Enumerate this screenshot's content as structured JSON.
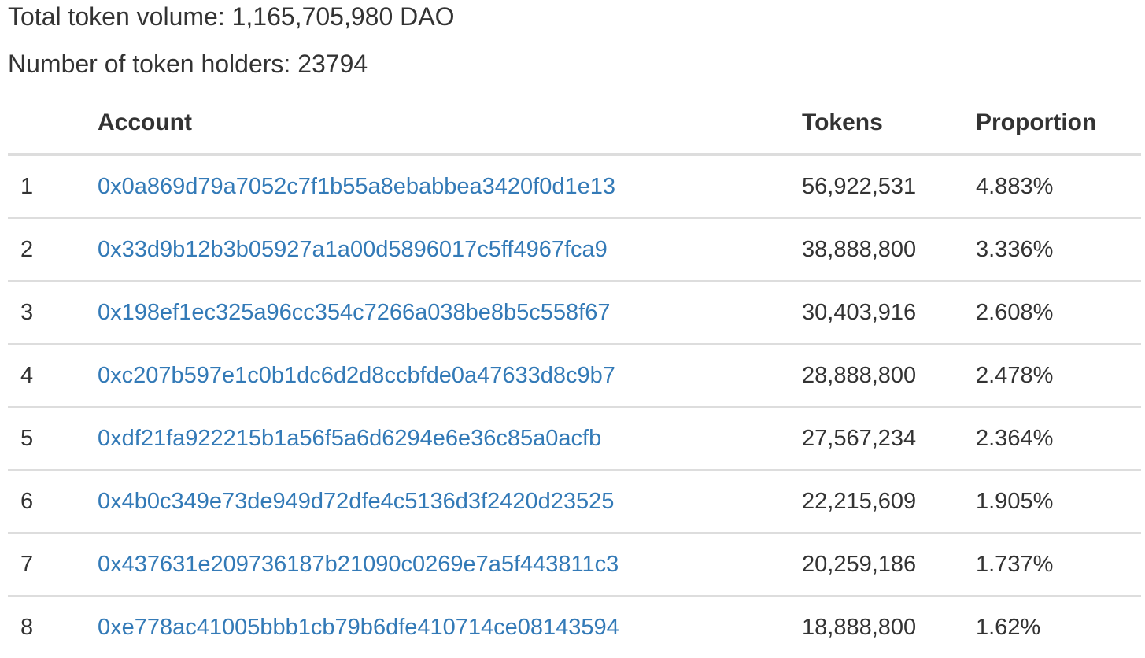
{
  "summary": {
    "total_label": "Total token volume: ",
    "total_value": "1,165,705,980 DAO",
    "holders_label": "Number of token holders: ",
    "holders_value": "23794"
  },
  "table": {
    "headers": {
      "rank": "",
      "account": "Account",
      "tokens": "Tokens",
      "proportion": "Proportion"
    },
    "rows": [
      {
        "rank": "1",
        "account": "0x0a869d79a7052c7f1b55a8ebabbea3420f0d1e13",
        "tokens": "56,922,531",
        "proportion": "4.883%"
      },
      {
        "rank": "2",
        "account": "0x33d9b12b3b05927a1a00d5896017c5ff4967fca9",
        "tokens": "38,888,800",
        "proportion": "3.336%"
      },
      {
        "rank": "3",
        "account": "0x198ef1ec325a96cc354c7266a038be8b5c558f67",
        "tokens": "30,403,916",
        "proportion": "2.608%"
      },
      {
        "rank": "4",
        "account": "0xc207b597e1c0b1dc6d2d8ccbfde0a47633d8c9b7",
        "tokens": "28,888,800",
        "proportion": "2.478%"
      },
      {
        "rank": "5",
        "account": "0xdf21fa922215b1a56f5a6d6294e6e36c85a0acfb",
        "tokens": "27,567,234",
        "proportion": "2.364%"
      },
      {
        "rank": "6",
        "account": "0x4b0c349e73de949d72dfe4c5136d3f2420d23525",
        "tokens": "22,215,609",
        "proportion": "1.905%"
      },
      {
        "rank": "7",
        "account": "0x437631e209736187b21090c0269e7a5f443811c3",
        "tokens": "20,259,186",
        "proportion": "1.737%"
      },
      {
        "rank": "8",
        "account": "0xe778ac41005bbb1cb79b6dfe410714ce08143594",
        "tokens": "18,888,800",
        "proportion": "1.62%"
      }
    ]
  },
  "colors": {
    "text": "#333333",
    "link": "#337ab7",
    "border": "#dddddd",
    "background": "#ffffff"
  }
}
